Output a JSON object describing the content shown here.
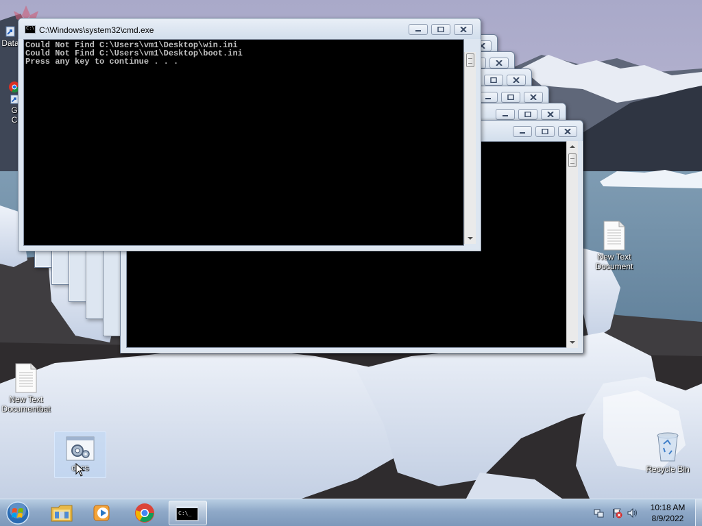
{
  "desktop": {
    "icons": [
      {
        "label": "Data"
      },
      {
        "label": "G"
      },
      {
        "label": "C"
      },
      {
        "label": "New Text Document"
      },
      {
        "label": "New Text Documentbat"
      },
      {
        "label": "docs"
      },
      {
        "label": "Recycle Bin"
      }
    ]
  },
  "front_window": {
    "title": "C:\\Windows\\system32\\cmd.exe",
    "lines": [
      "Could Not Find C:\\Users\\vm1\\Desktop\\win.ini",
      "Could Not Find C:\\Users\\vm1\\Desktop\\boot.ini",
      "Press any key to continue . . ."
    ]
  },
  "taskbar": {
    "clock_time": "10:18 AM",
    "clock_date": "8/9/2022"
  },
  "colors": {
    "console_bg": "#000000",
    "console_text": "#c0c0c0",
    "close_x": "#3a4a64",
    "taskbar": "#8fa9c8"
  },
  "icons": {
    "start": "windows-logo-icon",
    "explorer": "folder-icon",
    "media": "media-player-icon",
    "chrome": "chrome-icon",
    "cmd": "console-icon",
    "tray": [
      "network-icon",
      "action-center-flag-icon",
      "speaker-icon"
    ]
  }
}
